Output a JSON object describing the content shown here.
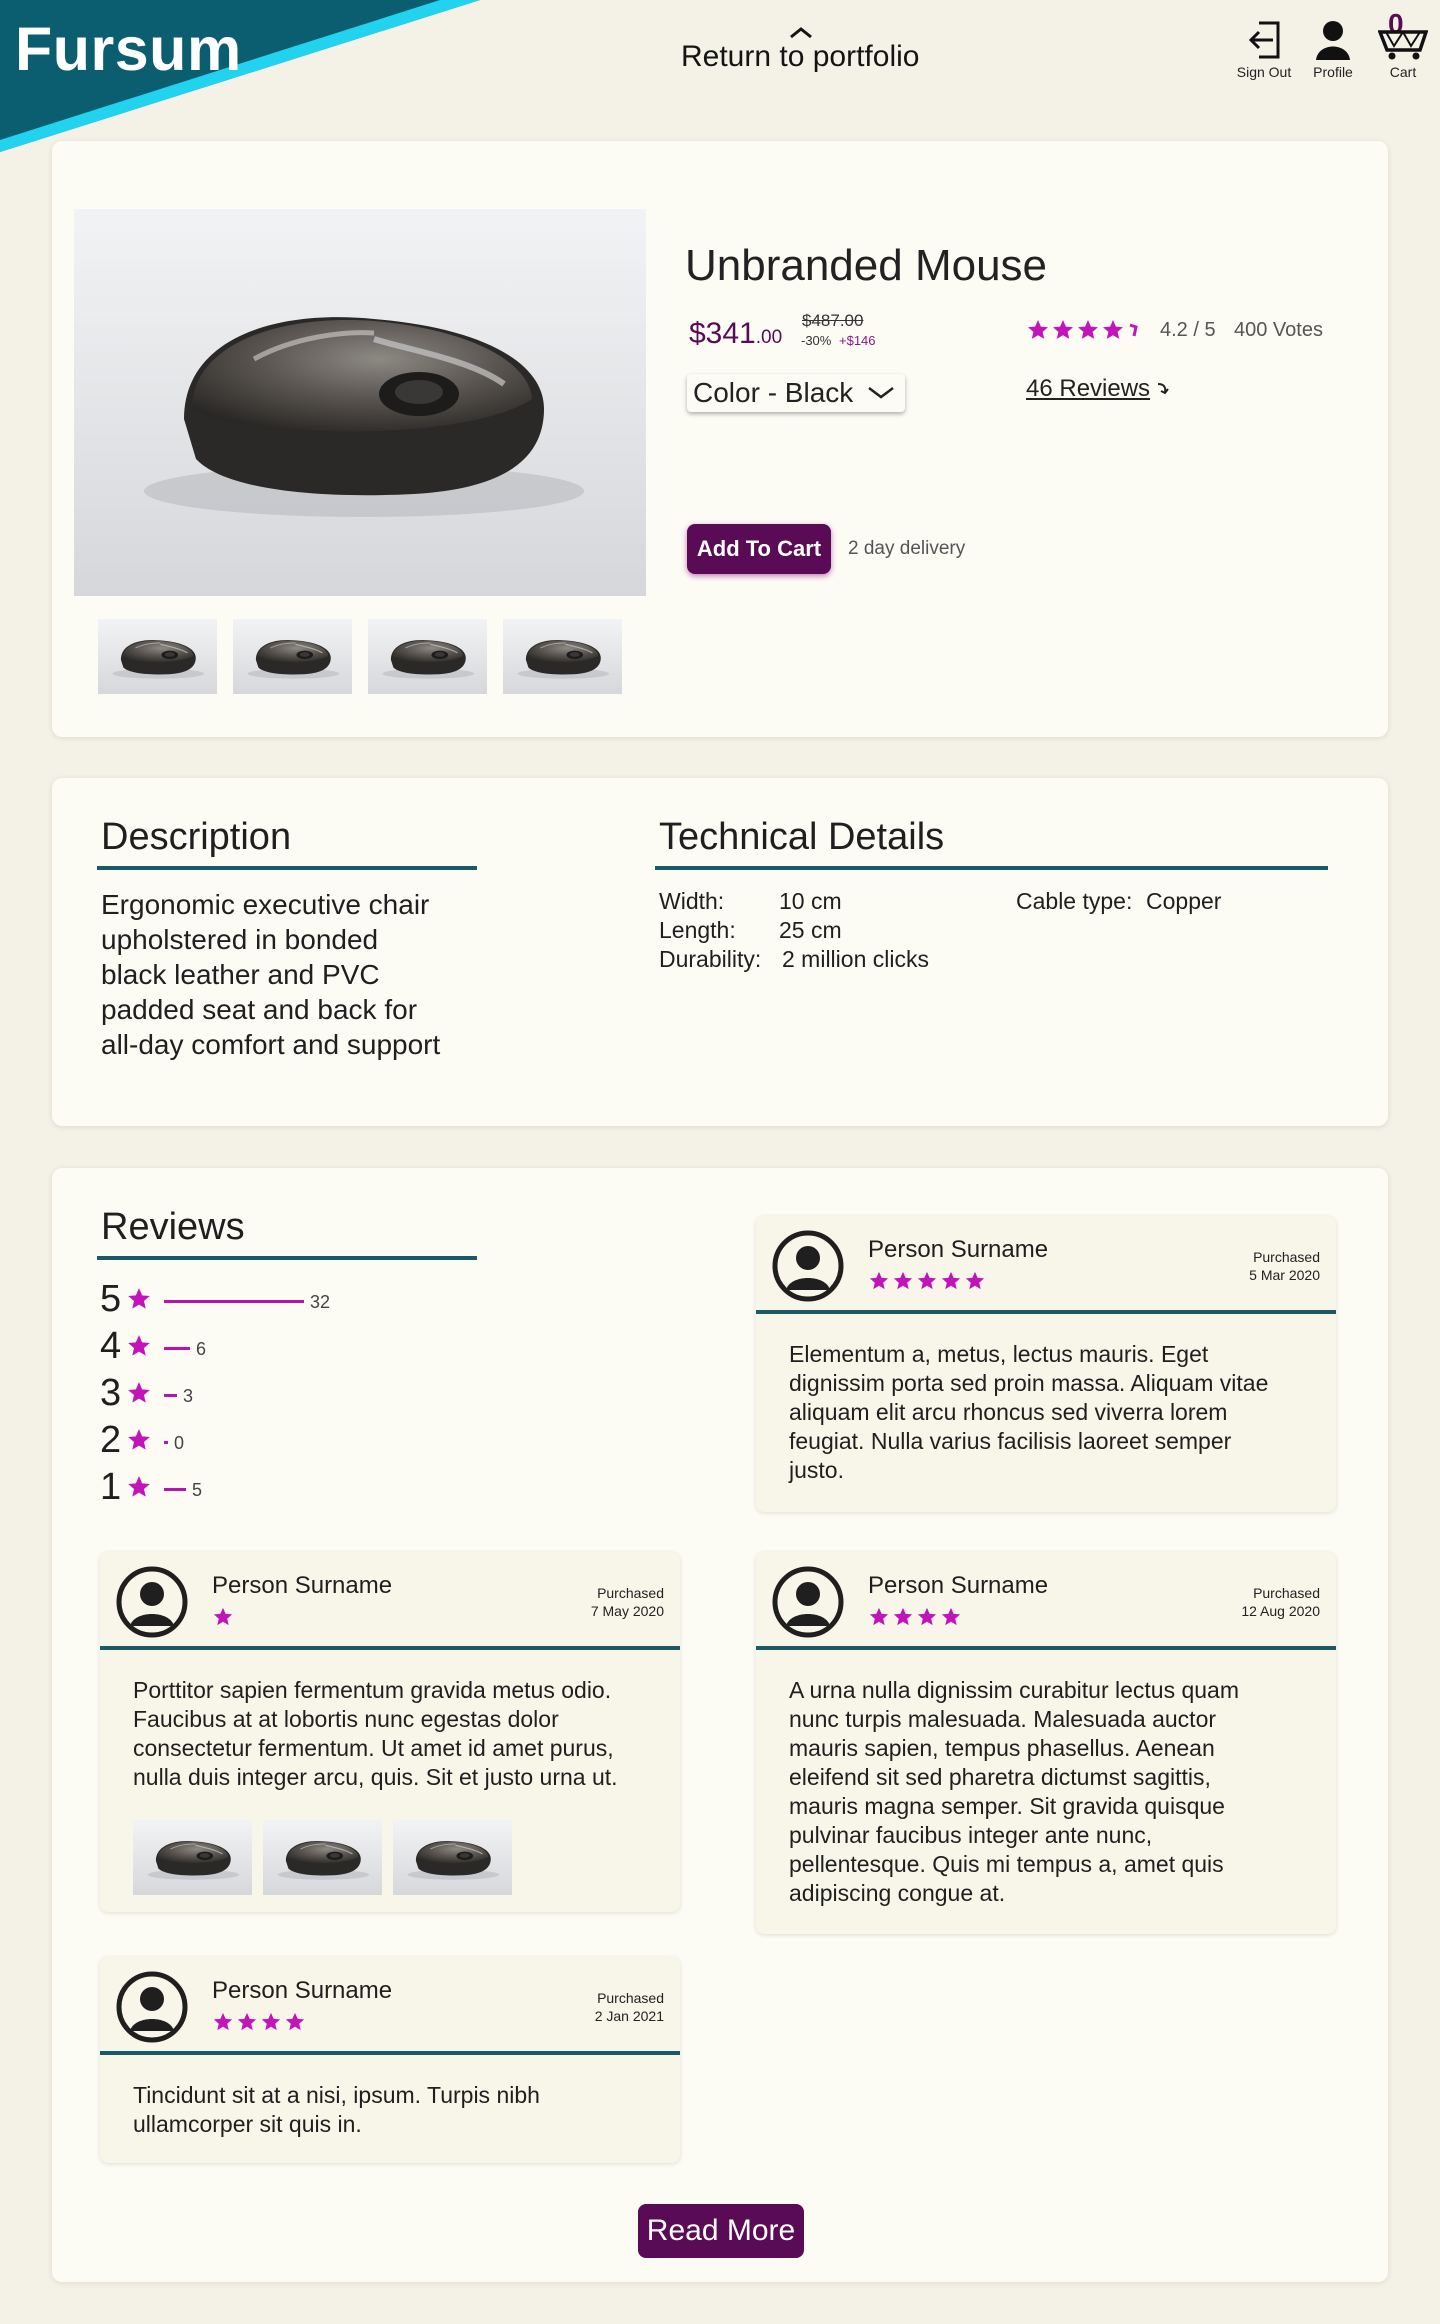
{
  "header": {
    "brand": "Fursum",
    "return_link": "Return to portfolio",
    "sign_out": "Sign Out",
    "profile": "Profile",
    "cart": "Cart",
    "cart_count": "0",
    "brand_color": "#0b5e70",
    "accent_stripe": "#22d3f0"
  },
  "product": {
    "title": "Unbranded Mouse",
    "price_main": "$341",
    "price_cents": ".00",
    "price_old": "$487.00",
    "discount": "-30%",
    "savings": "+$146",
    "rating_text": "4.2 / 5",
    "votes_text": "400 Votes",
    "rating_value": 4.2,
    "color_select": "Color - Black",
    "reviews_link": "46 Reviews",
    "add_to_cart": "Add To Cart",
    "delivery": "2 day delivery",
    "images": [
      "mouse-photo",
      "mouse-photo",
      "mouse-photo",
      "mouse-photo"
    ]
  },
  "description": {
    "title": "Description",
    "lines": [
      "Ergonomic executive chair",
      "upholstered in bonded",
      "black leather and PVC",
      "padded seat and back for",
      "all-day comfort and support"
    ]
  },
  "technical": {
    "title": "Technical Details",
    "rows": [
      {
        "key": "Width:",
        "value": "10 cm"
      },
      {
        "key": "Length:",
        "value": "25 cm"
      },
      {
        "key": "Durability:",
        "value": "2 million clicks"
      }
    ],
    "cable_key": "Cable type:",
    "cable_value": "Copper"
  },
  "reviews": {
    "title": "Reviews",
    "distribution": [
      {
        "stars": "5",
        "count": "32"
      },
      {
        "stars": "4",
        "count": "6"
      },
      {
        "stars": "3",
        "count": "3"
      },
      {
        "stars": "2",
        "count": "0"
      },
      {
        "stars": "1",
        "count": "5"
      }
    ],
    "items": [
      {
        "name": "Person Surname",
        "stars": 5,
        "purchased": "Purchased",
        "date": "5 Mar 2020",
        "text": [
          "Elementum a, metus, lectus mauris. Eget",
          "dignissim porta sed proin massa. Aliquam vitae",
          "aliquam elit arcu rhoncus sed viverra lorem",
          "feugiat. Nulla varius facilisis laoreet semper",
          "justo."
        ]
      },
      {
        "name": "Person Surname",
        "stars": 1,
        "purchased": "Purchased",
        "date": "7 May 2020",
        "text": [
          "Porttitor sapien fermentum gravida metus odio.",
          "Faucibus at at lobortis nunc egestas dolor",
          "consectetur fermentum. Ut amet id amet purus,",
          "nulla duis integer arcu, quis. Sit et justo urna ut."
        ]
      },
      {
        "name": "Person Surname",
        "stars": 4,
        "purchased": "Purchased",
        "date": "12 Aug 2020",
        "text": [
          "A urna nulla dignissim curabitur lectus quam",
          "nunc turpis malesuada. Malesuada auctor",
          "mauris sapien, tempus phasellus. Aenean",
          "eleifend sit sed pharetra dictumst sagittis,",
          "mauris magna semper. Sit gravida quisque",
          "pulvinar faucibus integer ante nunc,",
          "pellentesque. Quis mi tempus a, amet quis",
          "adipiscing congue at."
        ]
      },
      {
        "name": "Person Surname",
        "stars": 4,
        "purchased": "Purchased",
        "date": "2 Jan 2021",
        "text": [
          "Tincidunt sit at a nisi, ipsum. Turpis nibh",
          "ullamcorper sit quis in."
        ]
      }
    ],
    "read_more": "Read More",
    "star_color": "#c214ba",
    "button_color": "#5a0b55"
  }
}
